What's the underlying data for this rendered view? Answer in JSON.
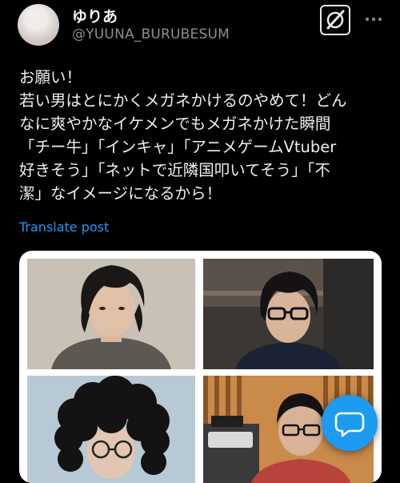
{
  "user": {
    "display_name": "ゆりあ",
    "handle": "@YUUNA_BURUBESUM"
  },
  "header": {
    "grok_icon": "grok-icon",
    "more_icon": "more-dots-icon"
  },
  "tweet": {
    "lines": [
      "お願い！",
      "若い男はとにかくメガネかけるのやめて！どん",
      "なに爽やかなイケメンでもメガネかけた瞬間",
      "「チー牛」「インキャ」「アニメゲームVtuber",
      "好きそう」「ネットで近隣国叩いてそう」「不",
      "潔」なイメージになるから！"
    ],
    "translate_label": "Translate post"
  },
  "colors": {
    "background": "#000000",
    "text": "#e7e9ea",
    "secondary": "#8b8f94",
    "accent": "#1d9bf0"
  },
  "fab": {
    "icon": "compose-reply-icon"
  }
}
